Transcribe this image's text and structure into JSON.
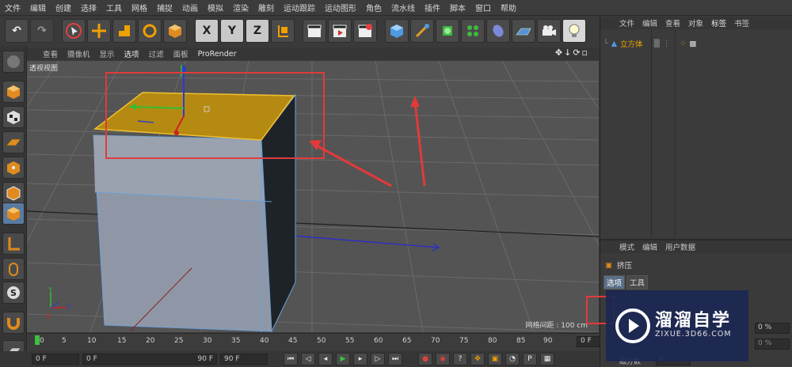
{
  "menu": [
    "文件",
    "编辑",
    "创建",
    "选择",
    "工具",
    "网格",
    "捕捉",
    "动画",
    "模拟",
    "渲染",
    "雕刻",
    "运动跟踪",
    "运动图形",
    "角色",
    "流水线",
    "插件",
    "脚本",
    "窗口",
    "帮助"
  ],
  "toolbar": {
    "axis_x": "X",
    "axis_y": "Y",
    "axis_z": "Z"
  },
  "viewport": {
    "menu": [
      "查看",
      "摄像机",
      "显示",
      "选项",
      "过滤",
      "面板"
    ],
    "renderer": "ProRender",
    "label": "透视视图",
    "grid_spacing": "网格间距 : 100 cm"
  },
  "timeline": {
    "ticks": [
      "0",
      "5",
      "10",
      "15",
      "20",
      "25",
      "30",
      "35",
      "40",
      "45",
      "50",
      "55",
      "60",
      "65",
      "70",
      "75",
      "80",
      "85",
      "90"
    ],
    "current_frame": "0 F"
  },
  "bottom": {
    "start": "0 F",
    "range_start": "0 F",
    "range_end": "90 F",
    "end": "90 F"
  },
  "object_manager": {
    "menu": [
      "文件",
      "编辑",
      "查看",
      "对象",
      "标签",
      "书签"
    ],
    "object_name": "立方体"
  },
  "attribute_manager": {
    "menu": [
      "模式",
      "编辑",
      "用户数据"
    ],
    "title": "挤压",
    "tabs": [
      "选项",
      "工具"
    ],
    "field1": "0 %",
    "field2": "0 %",
    "partial_label": "细分数",
    "partial_value": "0"
  },
  "watermark": {
    "title": "溜溜自学",
    "url": "ZIXUE.3D66.COM"
  },
  "colors": {
    "accent_orange": "#f0a500",
    "annotation_red": "#e23a3a",
    "selected_face": "#b58a12"
  }
}
